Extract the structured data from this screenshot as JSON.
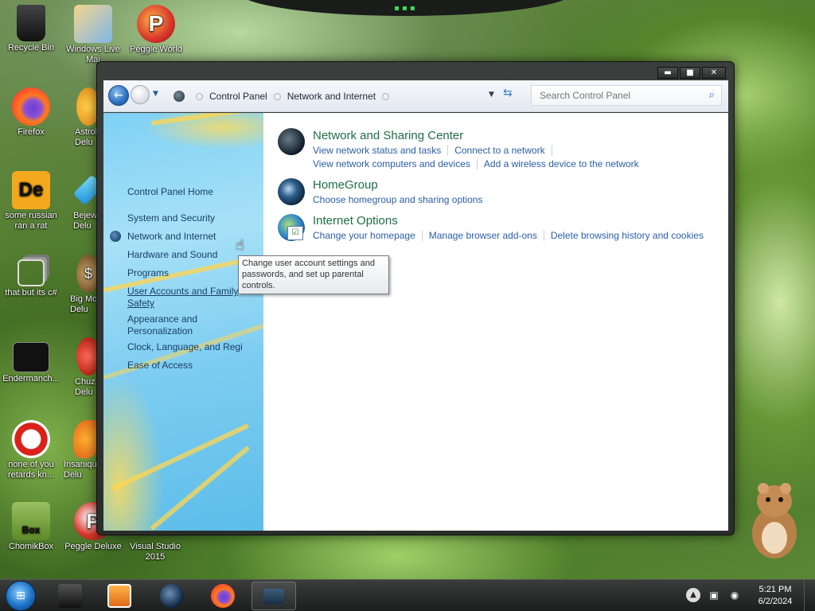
{
  "desktop": {
    "icons": [
      {
        "label": "Recycle Bin",
        "icon": "recycle-bin-icon"
      },
      {
        "label": "Windows Live Mai",
        "icon": "windows-live-mail-icon"
      },
      {
        "label": "Peggle World",
        "icon": "peggle-world-icon"
      },
      {
        "label": "Firefox",
        "icon": "firefox-icon"
      },
      {
        "label": "Astrol Delu",
        "icon": "astropop-deluxe-icon"
      },
      {
        "label": "some russian ran a rat",
        "icon": "de-icon"
      },
      {
        "label": "Bejew Delu",
        "icon": "bejeweled-deluxe-icon"
      },
      {
        "label": "that but its c#",
        "icon": "stacked-windows-icon"
      },
      {
        "label": "Big Mo Delu",
        "icon": "big-money-deluxe-icon"
      },
      {
        "label": "Endermanch...",
        "icon": "endermanch-icon"
      },
      {
        "label": "Chuz Delu",
        "icon": "chuzzle-deluxe-icon"
      },
      {
        "label": "none of you retards kn...",
        "icon": "red-dragon-icon"
      },
      {
        "label": "Insaniqu Delu",
        "icon": "insaniquarium-deluxe-icon"
      },
      {
        "label": "ChomikBox",
        "icon": "chomikbox-icon"
      },
      {
        "label": "Peggle Deluxe",
        "icon": "peggle-deluxe-icon"
      },
      {
        "label": "Visual Studio 2015",
        "icon": "visual-studio-icon"
      }
    ]
  },
  "window": {
    "controls": {
      "minimize": "▬",
      "maximize": "■",
      "close": "✕"
    },
    "breadcrumb": [
      "Control Panel",
      "Network and Internet"
    ],
    "search_placeholder": "Search Control Panel"
  },
  "sidebar": {
    "home": "Control Panel Home",
    "items": [
      {
        "label": "System and Security"
      },
      {
        "label": "Network and Internet",
        "active": true
      },
      {
        "label": "Hardware and Sound"
      },
      {
        "label": "Programs"
      },
      {
        "label": "User Accounts and Family Safety",
        "hover": true
      },
      {
        "label": "Appearance and Personalization"
      },
      {
        "label": "Clock, Language, and Regi"
      },
      {
        "label": "Ease of Access"
      }
    ]
  },
  "content": {
    "categories": [
      {
        "title": "Network and Sharing Center",
        "icon": "network-sharing-icon",
        "tasks_row1": [
          "View network status and tasks",
          "Connect to a network"
        ],
        "tasks_row2": [
          "View network computers and devices",
          "Add a wireless device to the network"
        ]
      },
      {
        "title": "HomeGroup",
        "icon": "homegroup-icon",
        "tasks_row1": [
          "Choose homegroup and sharing options"
        ]
      },
      {
        "title": "Internet Options",
        "icon": "internet-options-icon",
        "tasks_row1": [
          "Change your homepage",
          "Manage browser add-ons",
          "Delete browsing history and cookies"
        ]
      }
    ]
  },
  "tooltip": {
    "text": "Change user account settings and passwords, and set up parental controls."
  },
  "taskbar": {
    "start": "start-orb",
    "pinned": [
      "media-icon",
      "video-player-icon",
      "app-orb-icon",
      "firefox-icon",
      "control-panel-icon"
    ],
    "clock_time": "5:21 PM",
    "clock_date": "6/2/2024"
  },
  "colors": {
    "link": "#2a5ea6",
    "title": "#1f6e47",
    "sidebar_text": "#1a3e66"
  }
}
